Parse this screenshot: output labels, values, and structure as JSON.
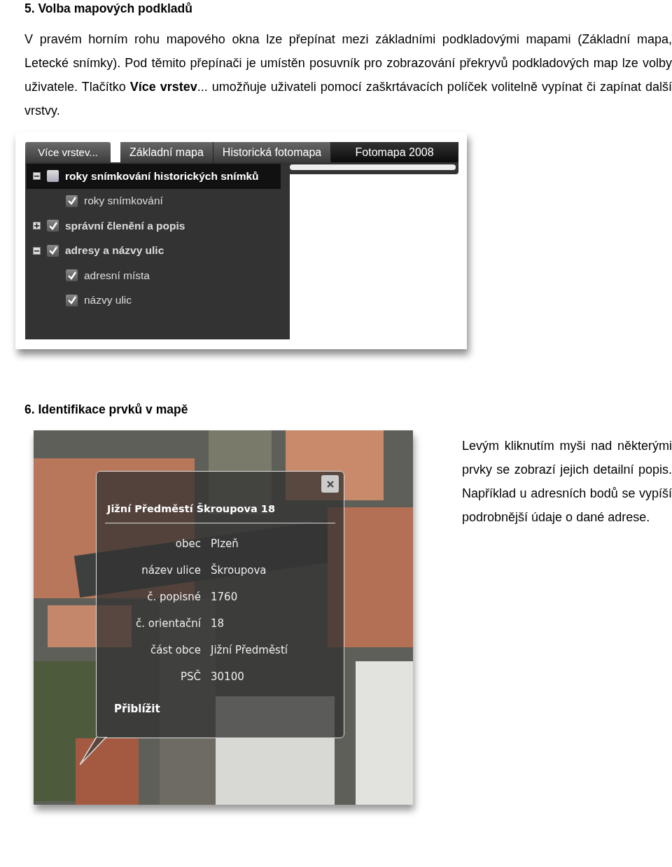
{
  "section_5": {
    "heading": "5.  Volba mapových podkladů",
    "paragraph": "V pravém horním rohu mapového okna lze přepínat mezi základními podkladovými mapami (Základní mapa, Letecké snímky). Pod těmito přepínači je umístěn posuvník pro zobrazování překryvů podkladových map lze volby uživatele. Tlačítko **Více vrstev**... umožňuje uživateli pomocí zaškrtávacích políček volitelně vypínat či zapínat další vrstvy.",
    "screenshot": {
      "layers_button": "Více vrstev...",
      "tabs": [
        {
          "label": "Základní mapa",
          "selected": false
        },
        {
          "label": "Historická fotomapa",
          "selected": false
        },
        {
          "label": "Fotomapa 2008",
          "selected": true
        }
      ],
      "overlay_slider": {
        "level": 1.0
      },
      "layers": [
        {
          "label": "roky snímkování historických snímků",
          "checked": false,
          "expanded": true,
          "selected": true,
          "children": [
            {
              "label": "roky snímkování",
              "checked": true,
              "selected": false
            }
          ]
        },
        {
          "label": "správní členění a popis",
          "checked": true,
          "expanded": false,
          "selected": false
        },
        {
          "label": "adresy a názvy ulic",
          "checked": true,
          "expanded": true,
          "selected": false,
          "children": [
            {
              "label": "adresní místa",
              "checked": true,
              "selected": false
            },
            {
              "label": "názvy ulic",
              "checked": true,
              "selected": false
            }
          ]
        }
      ]
    }
  },
  "section_6": {
    "heading": "6.  Identifikace prvků v mapě",
    "map": {
      "kind": "picture",
      "popup": {
        "title": "Jižní Předměstí  Škroupova 18",
        "rows": [
          {
            "label": "obec",
            "value": "Plzeň"
          },
          {
            "label": "název ulice",
            "value": "Škroupova"
          },
          {
            "label": "č. popisné",
            "value": "1760"
          },
          {
            "label": "č. orientační",
            "value": "18"
          },
          {
            "label": "část obce",
            "value": "Jižní Předměstí"
          },
          {
            "label": "PSČ",
            "value": "30100"
          }
        ],
        "zoom_link": "Přiblížit"
      }
    },
    "paragraph": "Levým kliknutím myši nad některými prvky se zobrazí jejich detailní popis. Například u adresních bodů se vypíší podrobnější údaje o dané adrese."
  }
}
